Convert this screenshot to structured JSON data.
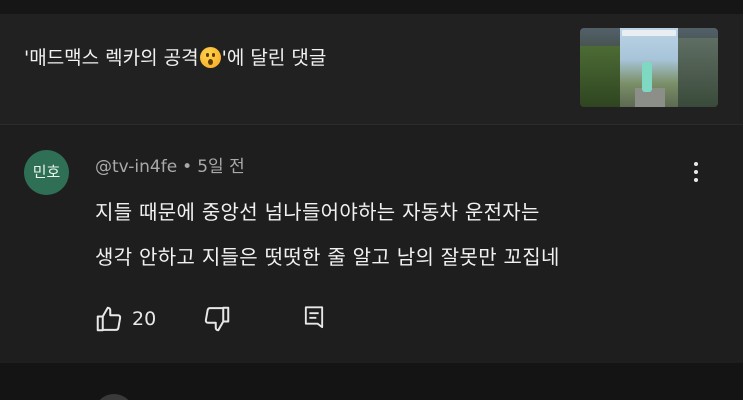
{
  "video": {
    "title_before_emoji": "'매드맥스 렉카의 공격",
    "title_after_emoji": "'에 달린 댓글",
    "emoji_icon": "astonished-face-emoji",
    "thumbnail_icon": "video-thumbnail-image"
  },
  "comment": {
    "avatar_text": "민호",
    "avatar_color": "#2f6f55",
    "author": "@tv-in4fe",
    "separator": "•",
    "time": "5일 전",
    "lines": [
      "지들 때문에 중앙선 넘나들어야하는 자동차 운전자는",
      "생각 안하고 지들은 떳떳한 줄 알고 남의 잘못만 꼬집네"
    ],
    "like_count": "20",
    "icons": {
      "more": "more-vertical-icon",
      "like": "thumbs-up-icon",
      "dislike": "thumbs-down-icon",
      "reply": "reply-comment-icon"
    }
  },
  "colors": {
    "background": "#1e1e1e",
    "text_primary": "#f1f1f1",
    "text_secondary": "#a9a9a9"
  }
}
